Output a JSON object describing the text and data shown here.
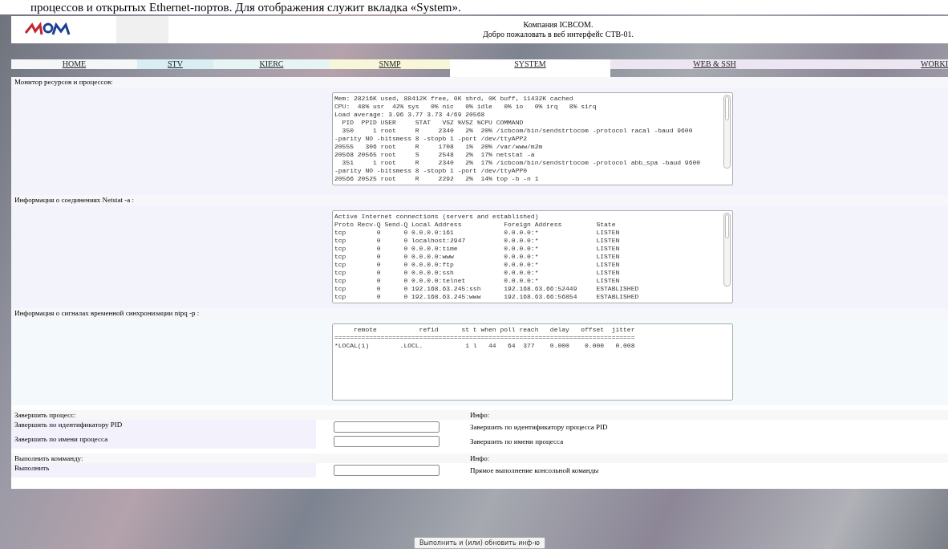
{
  "caption": "процессов и открытых Ethernet-портов. Для отображения служит вкладка «System».",
  "header": {
    "company": "Компания ICBCOM.",
    "welcome": "Добро пожаловать в веб интерфейс СТВ-01."
  },
  "tabs": [
    {
      "label": "HOME",
      "selected": false,
      "color": "#f4f6f8"
    },
    {
      "label": "STV",
      "selected": false,
      "color": "#d8eef2"
    },
    {
      "label": "KIERC",
      "selected": false,
      "color": "#e6f4f4"
    },
    {
      "label": "SNMP",
      "selected": false,
      "color": "#f8f6d8"
    },
    {
      "label": "SYSTEM",
      "selected": true,
      "color": "#ffffff"
    },
    {
      "label": "WEB & SSH",
      "selected": false,
      "color": "#ece6f2"
    },
    {
      "label": "WORKI",
      "selected": false,
      "color": "#ece6f2"
    }
  ],
  "sections": [
    {
      "title": "Монитор ресурсов и процессов:",
      "lines": [
        "Mem: 28216K used, 88412K free, 0K shrd, 0K buff, 11432K cached",
        "CPU:  48% usr  42% sys   0% nic   0% idle   0% io   0% irq   8% sirq",
        "Load average: 3.96 3.77 3.73 4/69 20568",
        "  PID  PPID USER     STAT   VSZ %VSZ %CPU COMMAND",
        "  350     1 root     R     2340   2%  20% /icbcom/bin/sendstrtocom -protocol racal -baud 9600",
        "-parity NO -bitsmess 8 -stopb 1 -port /dev/ttyAPP2",
        "20555   306 root     R     1708   1%  20% /var/www/m2m",
        "20568 20565 root     S     2548   2%  17% netstat -a",
        "  351     1 root     R     2340   2%  17% /icbcom/bin/sendstrtocom -protocol abb_spa -baud 9600",
        "-parity NO -bitsmess 8 -stopb 1 -port /dev/ttyAPP0",
        "20566 20525 root     R     2292   2%  14% top -b -n 1"
      ]
    },
    {
      "title": "Информация о соединениях Netstat -a :",
      "lines": [
        "Active Internet connections (servers and established)",
        "Proto Recv-Q Send-Q Local Address           Foreign Address         State",
        "tcp        0      0 0.0.0.0:161             0.0.0.0:*               LISTEN",
        "tcp        0      0 localhost:2947          0.0.0.0:*               LISTEN",
        "tcp        0      0 0.0.0.0:time            0.0.0.0:*               LISTEN",
        "tcp        0      0 0.0.0.0:www             0.0.0.0:*               LISTEN",
        "tcp        0      0 0.0.0.0:ftp             0.0.0.0:*               LISTEN",
        "tcp        0      0 0.0.0.0:ssh             0.0.0.0:*               LISTEN",
        "tcp        0      0 0.0.0.0:telnet          0.0.0.0:*               LISTEN",
        "tcp        0      0 192.168.63.245:ssh      192.168.63.66:52449     ESTABLISHED",
        "tcp        0      0 192.168.63.245:www      192.168.63.66:56854     ESTABLISHED"
      ]
    },
    {
      "title": "Информация о сигналах временной синхронизации ntpq -p :",
      "lines": [
        "     remote           refid      st t when poll reach   delay   offset  jitter",
        "==============================================================================",
        "*LOCAL(1)        .LOCL.           1 l   44   64  377    0.000    0.000   0.008"
      ]
    }
  ],
  "forms": [
    {
      "title": "Завершить процесс:",
      "info_title": "Инфо:",
      "rows": [
        {
          "label": "Завершить по идентификатору PID",
          "info": "Завершить по идентификатору процесса PID"
        },
        {
          "label": "Завершить по имени процесса",
          "info": "Завершить по имени процесса"
        }
      ]
    },
    {
      "title": "Выполнить комманду:",
      "info_title": "Инфо:",
      "rows": [
        {
          "label": "Выполнить",
          "info": "Прямое выполнение консольной команды"
        }
      ]
    }
  ],
  "footer_button": "Выполнить и (или) обновить инф-ю"
}
